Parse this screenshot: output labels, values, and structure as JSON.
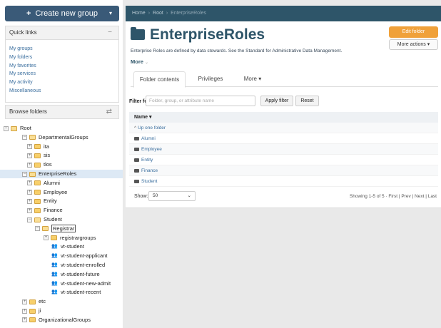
{
  "create_button": {
    "label": "Create new group",
    "plus": "+",
    "caret": "▾"
  },
  "quick_links": {
    "title": "Quick links",
    "toggle": "−",
    "items": [
      "My groups",
      "My folders",
      "My favorites",
      "My services",
      "My activity",
      "Miscellaneous"
    ]
  },
  "browse": {
    "title": "Browse folders",
    "toggle": "⇄"
  },
  "tree": [
    {
      "label": "Root",
      "kind": "folder-open",
      "toggle": "−"
    },
    {
      "label": "DepartmentalGroups",
      "kind": "folder-open",
      "toggle": "−"
    },
    {
      "label": "ita",
      "kind": "folder",
      "toggle": "+"
    },
    {
      "label": "sis",
      "kind": "folder",
      "toggle": "+"
    },
    {
      "label": "tlos",
      "kind": "folder",
      "toggle": "+"
    },
    {
      "label": "EnterpriseRoles",
      "kind": "folder-open",
      "toggle": "−"
    },
    {
      "label": "Alumni",
      "kind": "folder",
      "toggle": "+"
    },
    {
      "label": "Employee",
      "kind": "folder",
      "toggle": "+"
    },
    {
      "label": "Entity",
      "kind": "folder",
      "toggle": "+"
    },
    {
      "label": "Finance",
      "kind": "folder",
      "toggle": "+"
    },
    {
      "label": "Student",
      "kind": "folder-open",
      "toggle": "−"
    },
    {
      "label": "Registrar",
      "kind": "folder-open",
      "toggle": "−"
    },
    {
      "label": "registrargroups",
      "kind": "folder",
      "toggle": "+"
    },
    {
      "label": "vt-student",
      "kind": "group"
    },
    {
      "label": "vt-student-applicant",
      "kind": "group"
    },
    {
      "label": "vt-student-enrolled",
      "kind": "group"
    },
    {
      "label": "vt-student-future",
      "kind": "group"
    },
    {
      "label": "vt-student-new-admit",
      "kind": "group"
    },
    {
      "label": "vt-student-recent",
      "kind": "group"
    },
    {
      "label": "etc",
      "kind": "folder",
      "toggle": "+"
    },
    {
      "label": "ji",
      "kind": "folder",
      "toggle": "+"
    },
    {
      "label": "OrganizationalGroups",
      "kind": "folder",
      "toggle": "+"
    }
  ],
  "breadcrumb": {
    "home": "Home",
    "root": "Root",
    "current": "EnterpriseRoles",
    "separator": "›"
  },
  "folder": {
    "title": "EnterpriseRoles",
    "description": "Enterprise Roles are defined by data stewards. See the Standard for Administrative Data Management.",
    "more_label": "More",
    "more_caret": "⌄"
  },
  "actions": {
    "edit": "Edit folder",
    "more": "More actions ▾"
  },
  "tabs": [
    "Folder contents",
    "Privileges",
    "More ▾"
  ],
  "filter": {
    "label": "Filter for:",
    "placeholder": "Folder, group, or attribute name",
    "apply": "Apply filter",
    "reset": "Reset"
  },
  "table": {
    "header": "Name ▾",
    "up_label": "Up one folder",
    "up_arrow": "^",
    "rows": [
      "Alumni",
      "Employee",
      "Entity",
      "Finance",
      "Student"
    ]
  },
  "pagination": {
    "show_label": "Show:",
    "show_value": "50",
    "caret": "⌄",
    "summary": "Showing 1-5 of 5 · First | Prev | Next | Last"
  },
  "colors": {
    "header": "#2e5569",
    "accent": "#f0a13a",
    "link": "#3a6e9e",
    "selected": "#dde9f5"
  }
}
